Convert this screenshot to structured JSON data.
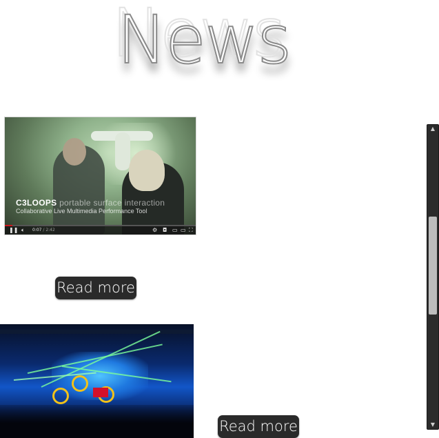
{
  "header": {
    "title": "News"
  },
  "video": {
    "caption_brand": "C3LOOPS",
    "caption_title_rest": " portable surface interaction",
    "caption_subtitle": "Collaborative Live Multimedia Performance Tool",
    "current_time": "0:07",
    "duration": " / 2:42",
    "progress": 0.04,
    "icons": [
      "pause-icon",
      "volume-icon",
      "settings-icon",
      "captions-icon",
      "miniplayer-icon",
      "theater-icon",
      "fullscreen-icon"
    ]
  },
  "articles": [
    {
      "read_more_label": "Read more"
    },
    {
      "read_more_label": "Read more"
    }
  ],
  "colors": {
    "button_bg": "#2a2a2a",
    "button_text": "#ffffff",
    "scrollbar_track": "#2b2b2b",
    "scrollbar_thumb": "#bdbdbd",
    "progress_fill": "#cc181e"
  },
  "scrollbar": {
    "position_fraction": 0.3
  }
}
